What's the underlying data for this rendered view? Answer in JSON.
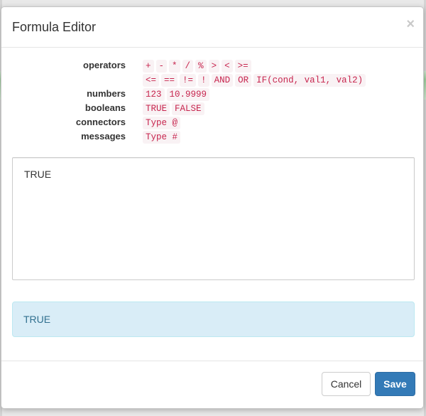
{
  "dialog": {
    "title": "Formula Editor",
    "close_glyph": "×"
  },
  "legend": {
    "operators": {
      "label": "operators",
      "line1": [
        "+",
        "-",
        "*",
        "/",
        "%",
        ">",
        "<",
        ">="
      ],
      "line2": [
        "<=",
        "==",
        "!=",
        "!",
        "AND",
        "OR",
        "IF(cond, val1, val2)"
      ]
    },
    "numbers": {
      "label": "numbers",
      "items": [
        "123",
        "10.9999"
      ]
    },
    "booleans": {
      "label": "booleans",
      "items": [
        "TRUE",
        "FALSE"
      ]
    },
    "connectors": {
      "label": "connectors",
      "items": [
        "Type @"
      ]
    },
    "messages": {
      "label": "messages",
      "items": [
        "Type #"
      ]
    }
  },
  "editor": {
    "value": "TRUE"
  },
  "result": {
    "value": "TRUE"
  },
  "footer": {
    "cancel_label": "Cancel",
    "save_label": "Save"
  },
  "colors": {
    "chip_text": "#c7254e",
    "chip_bg": "#f9f2f4",
    "result_bg": "#d9edf7",
    "result_text": "#31708f",
    "primary": "#337ab7"
  }
}
